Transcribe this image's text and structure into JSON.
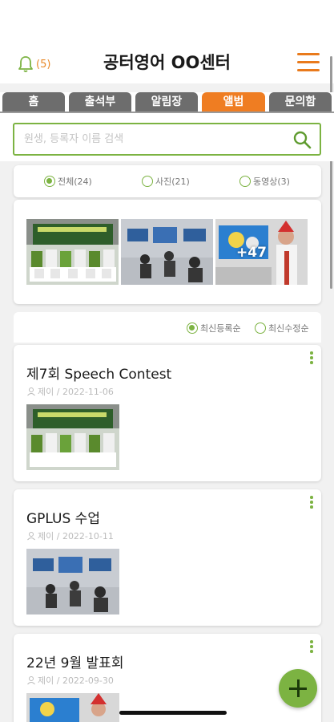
{
  "header": {
    "notification_count": "(5)",
    "title": "공터영어 OO센터",
    "icons": {
      "bell": "bell-icon",
      "menu": "hamburger-menu-icon"
    },
    "colors": {
      "accent_orange": "#ef7d22",
      "accent_green": "#7cb342",
      "tab_gray": "#6d6d6d"
    }
  },
  "tabs": [
    {
      "label": "홈",
      "active": false
    },
    {
      "label": "출석부",
      "active": false
    },
    {
      "label": "알림장",
      "active": false
    },
    {
      "label": "앨범",
      "active": true
    },
    {
      "label": "문의함",
      "active": false
    }
  ],
  "search": {
    "placeholder": "원생, 등록자 이름 검색",
    "icon": "search-icon"
  },
  "filters": [
    {
      "label": "전체(24)",
      "selected": true
    },
    {
      "label": "사진(21)",
      "selected": false
    },
    {
      "label": "동영상(3)",
      "selected": false
    }
  ],
  "preview": {
    "more_count": "+47"
  },
  "sort": [
    {
      "label": "최신등록순",
      "selected": true
    },
    {
      "label": "최신수정순",
      "selected": false
    }
  ],
  "posts": [
    {
      "title": "제7회 Speech Contest",
      "meta": "제이 / 2022-11-06"
    },
    {
      "title": "GPLUS 수업",
      "meta": "제이 / 2022-10-11"
    },
    {
      "title": "22년 9월 발표회",
      "meta": "제이 / 2022-09-30"
    }
  ]
}
